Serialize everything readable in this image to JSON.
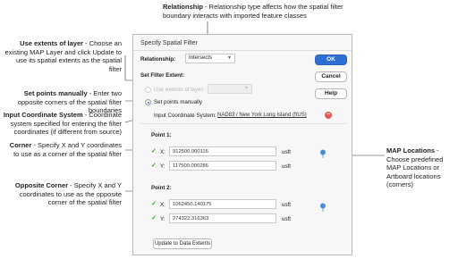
{
  "annotations": {
    "relationship": {
      "title": "Relationship",
      "text": " - Relationship type affects how the spatial filter boundary interacts with imported feature classes"
    },
    "use_extents": {
      "title": "Use extents of layer",
      "text": " - Choose an existing MAP Layer and click Update to use its spatial extents as the spatial filter"
    },
    "set_points": {
      "title": "Set points manually",
      "text": " - Enter two opposite corners of the spatial filter boundaries"
    },
    "input_cs": {
      "title": "Input Coordinate System",
      "text": " - Coordinate system specified for entering the filter coordinates (if different from source)"
    },
    "corner": {
      "title": "Corner",
      "text": " - Specify X and Y coordinates to use as a corner of the spatial filter"
    },
    "opposite_corner": {
      "title": "Opposite Corner",
      "text": " - Specify X and Y coordinates to use as the  opposite corner of the spatial filter"
    },
    "map_locations": {
      "title": "MAP Locations",
      "text": " - Choose predefined MAP Locations or Artboard locations (corners)"
    }
  },
  "dialog": {
    "title": "Specify Spatial Filter",
    "relationship_label": "Relationship:",
    "relationship_value": "Intersects",
    "set_filter_extent_label": "Set Filter Extent:",
    "use_extents_label": "Use extents of layer:",
    "use_extents_value": "",
    "set_points_label": "Set points manually",
    "input_cs_label": "Input Coordinate System:",
    "input_cs_value": "NAD83 / New York Long Island (ftUS)",
    "point1_label": "Point 1:",
    "point1_x_label": "X:",
    "point1_x_value": "912500.000116",
    "point1_y_label": "Y:",
    "point1_y_value": "117500.000286",
    "point1_x_unit": "usft",
    "point1_y_unit": "usft",
    "point2_label": "Point 2:",
    "point2_x_label": "X:",
    "point2_x_value": "1062450.140175",
    "point2_y_label": "Y:",
    "point2_y_value": "274322.316363",
    "point2_x_unit": "usft",
    "point2_y_unit": "usft",
    "update_button": "Update to Data Extents",
    "ok_button": "OK",
    "cancel_button": "Cancel",
    "help_button": "Help"
  },
  "colors": {
    "primary": "#2f6fd3",
    "remove": "#e35b5b",
    "check": "#3aa23a",
    "pin": "#4a8fd8"
  },
  "icons": {
    "check": "checkmark-icon",
    "remove": "minus-circle-icon",
    "pin": "map-pin-icon",
    "chevron": "chevron-down-icon"
  }
}
